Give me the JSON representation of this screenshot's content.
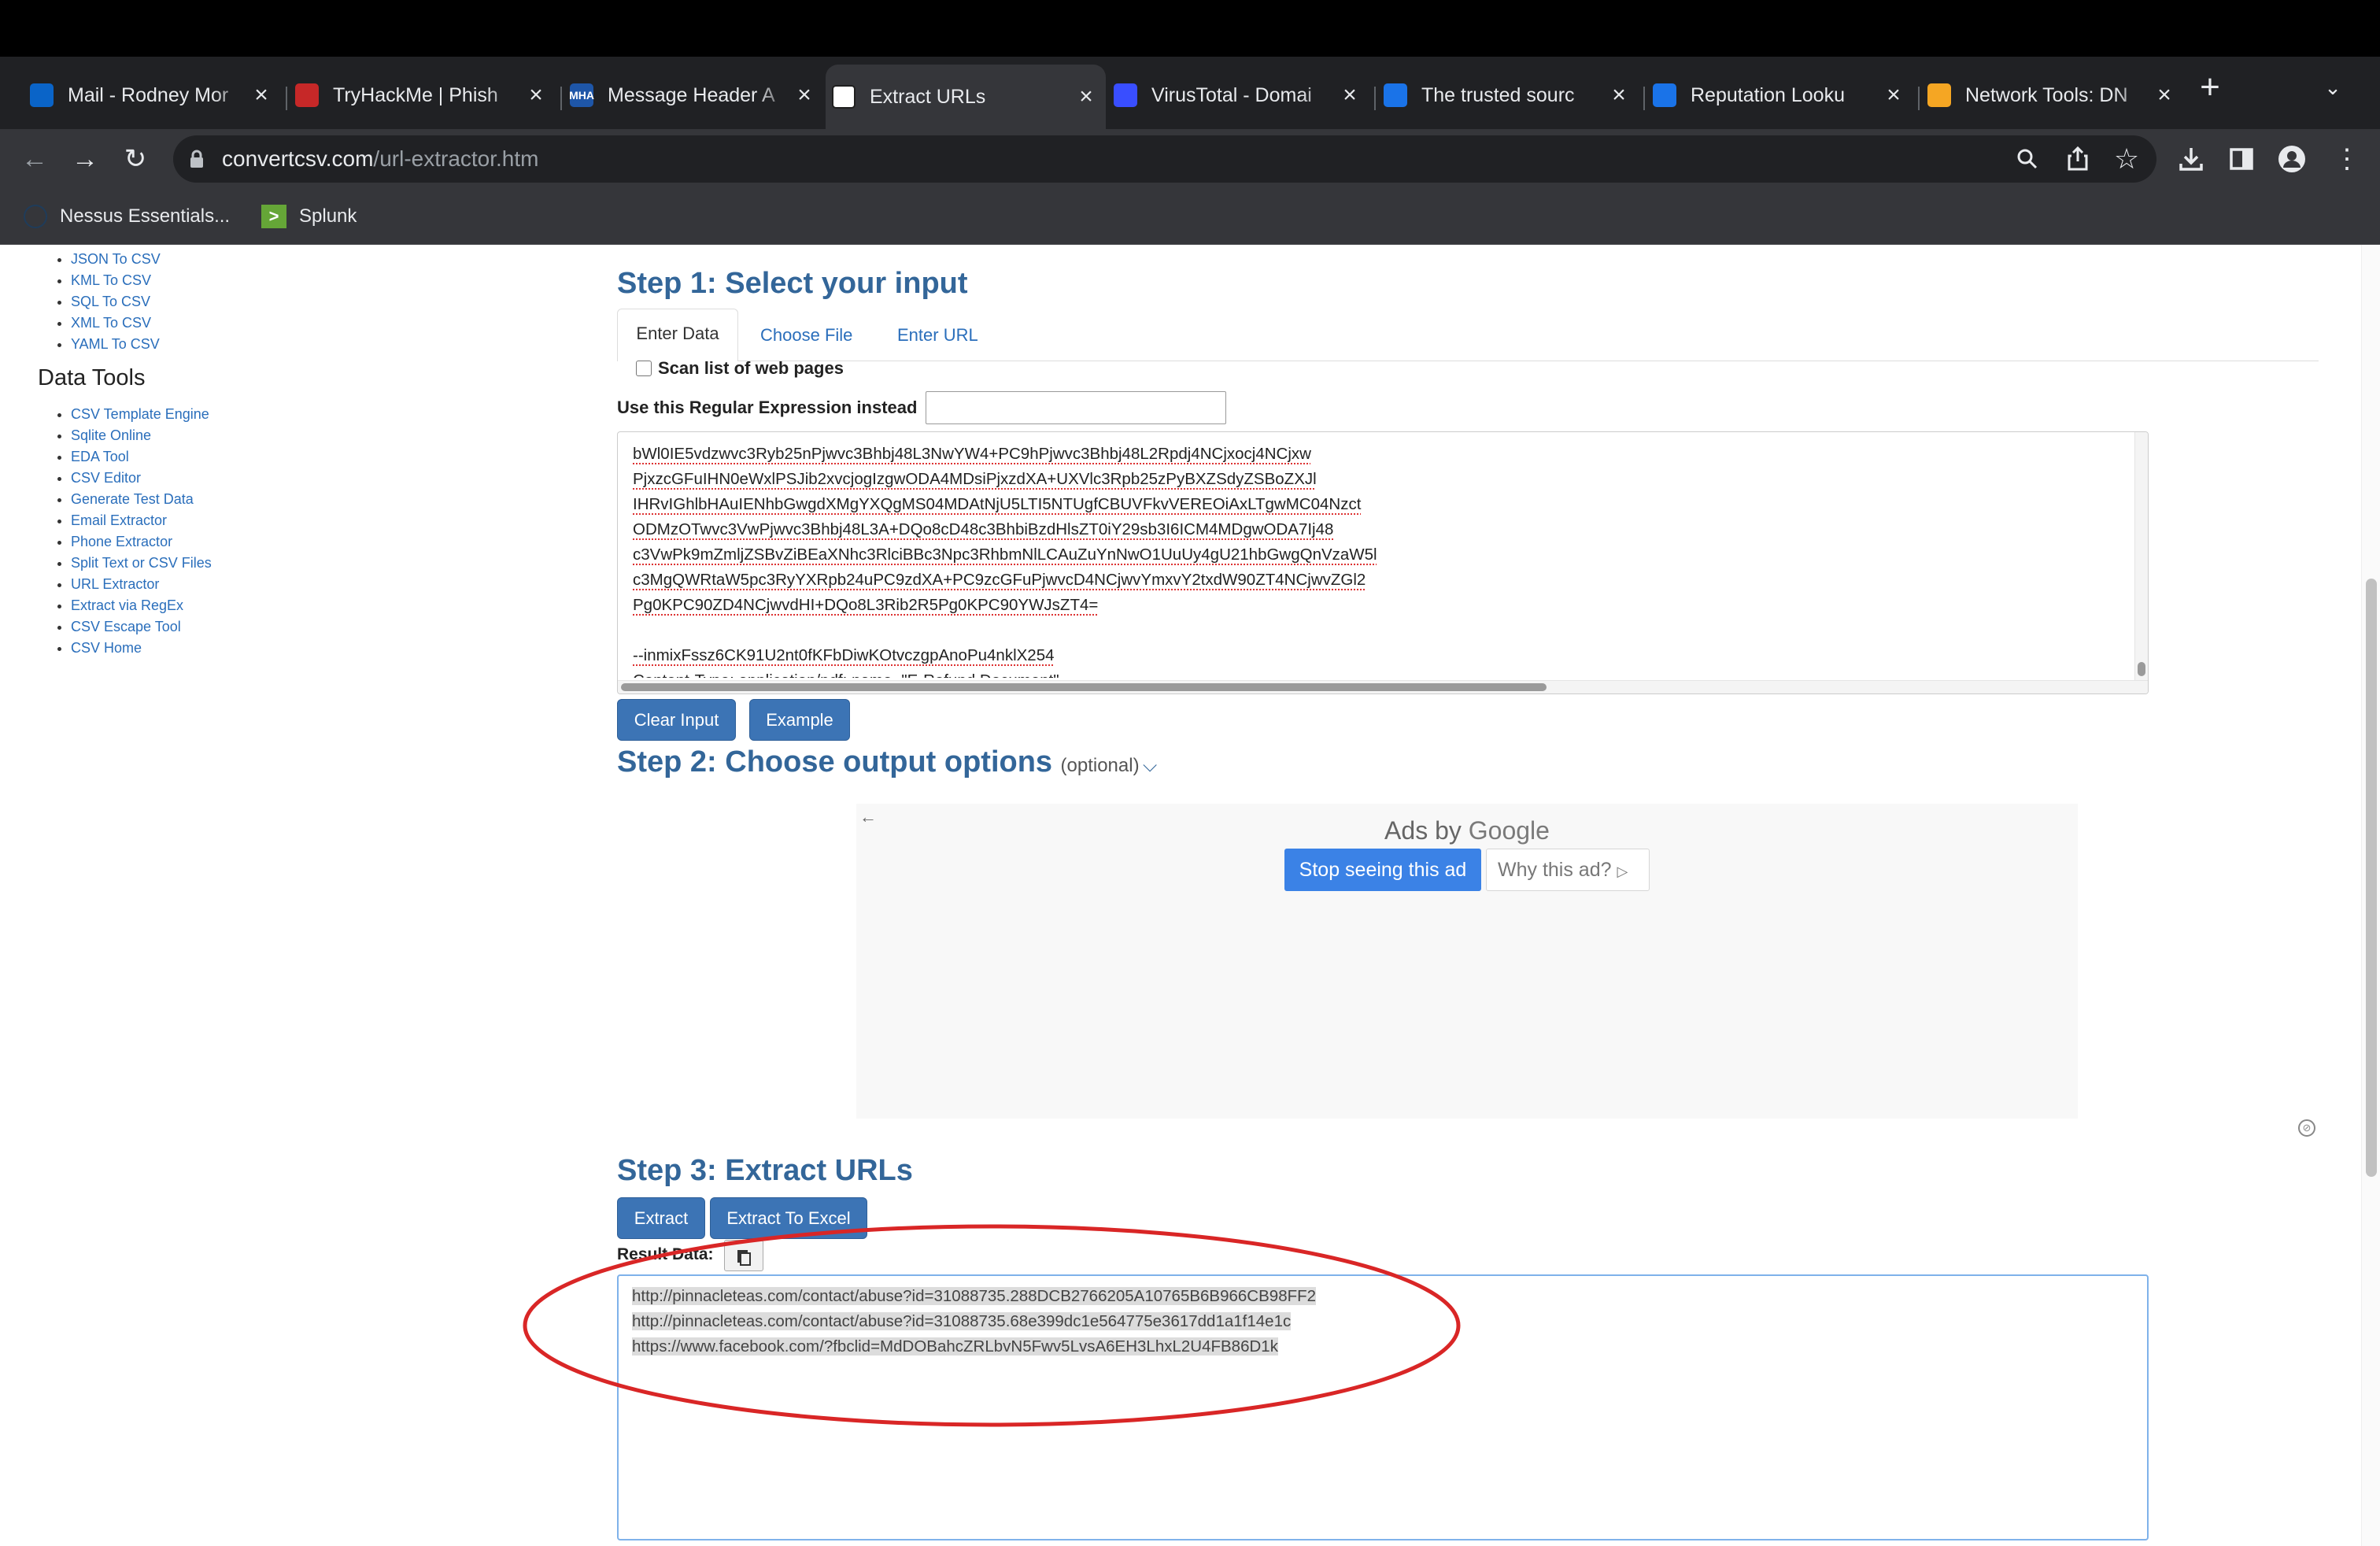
{
  "browser": {
    "tabs": [
      {
        "title": "Mail - Rodney Mor",
        "active": false,
        "favicon_color": "#0a64c8",
        "favicon": "outlook-icon"
      },
      {
        "title": "TryHackMe | Phish",
        "active": false,
        "favicon_color": "#c62828",
        "favicon": "tryhackme-icon"
      },
      {
        "title": "Message Header A",
        "active": false,
        "favicon_color": "#1e56a8",
        "favicon": "mha-icon",
        "favicon_text": "MHA"
      },
      {
        "title": "Extract URLs",
        "active": true,
        "favicon_color": "#ffffff",
        "favicon": "convertcsv-icon"
      },
      {
        "title": "VirusTotal - Domai",
        "active": false,
        "favicon_color": "#394eff",
        "favicon": "virustotal-icon"
      },
      {
        "title": "The trusted sourc",
        "active": false,
        "favicon_color": "#1a73e8",
        "favicon": "location-pin-icon"
      },
      {
        "title": "Reputation Looku",
        "active": false,
        "favicon_color": "#1a73e8",
        "favicon": "circle-icon"
      },
      {
        "title": "Network Tools: DN",
        "active": false,
        "favicon_color": "#f5a623",
        "favicon": "network-tools-icon"
      }
    ],
    "url_domain": "convertcsv.com",
    "url_path": "/url-extractor.htm",
    "bookmarks": [
      {
        "label": "Nessus Essentials...",
        "icon": "nessus-icon"
      },
      {
        "label": "Splunk",
        "icon": "splunk-icon",
        "icon_text": ">"
      }
    ]
  },
  "sidebar": {
    "convert_items": [
      "JSON To CSV",
      "KML To CSV",
      "SQL To CSV",
      "XML To CSV",
      "YAML To CSV"
    ],
    "data_tools_heading": "Data Tools",
    "data_tools_items": [
      "CSV Template Engine",
      "Sqlite Online",
      "EDA Tool",
      "CSV Editor",
      "Generate Test Data",
      "Email Extractor",
      "Phone Extractor",
      "Split Text or CSV Files",
      "URL Extractor",
      "Extract via RegEx",
      "CSV Escape Tool",
      "CSV Home"
    ]
  },
  "step1": {
    "heading": "Step 1: Select your input",
    "tabs": [
      "Enter Data",
      "Choose File",
      "Enter URL"
    ],
    "scan_label": "Scan list of web pages",
    "regex_label": "Use this Regular Expression instead",
    "regex_value": "",
    "input_text": "bWl0IE5vdzwvc3Ryb25nPjwvc3Bhbj48L3NwYW4+PC9hPjwvc3Bhbj48L2Rpdj4NCjxocj4NCjxw\nPjxzcGFuIHN0eWxlPSJib2xvcjogIzgwODA4MDsiPjxzdXA+UXVlc3Rpb25zPyBXZSdyZSBoZXJl\nIHRvIGhlbHAuIENhbGwgdXMgYXQgMS04MDAtNjU5LTI5NTUgfCBUVFkvVEREOiAxLTgwMC04Nzct\nODMzOTwvc3VwPjwvc3Bhbj48L3A+DQo8cD48c3BhbiBzdHlsZT0iY29sb3I6ICM4MDgwODA7Ij48\nc3VwPk9mZmljZSBvZiBEaXNhc3RlciBBc3Npc3RhbmNlLCAuZuYnNwO1UuUy4gU21hbGwgQnVzaW5l\nc3MgQWRtaW5pc3RyYXRpb24uPC9zdXA+PC9zcGFuPjwvcD4NCjwvYmxvY2txdW90ZT4NCjwvZGl2\nPg0KPC90ZD4NCjwvdHI+DQo8L3Rib2R5Pg0KPC90YWJsZT4=\n\n--inmixFssz6CK91U2nt0fKFbDiwKOtvczgpAnoPu4nklX254\nContent-Type: application/pdf; name=\"E-Refund.Document\""
  },
  "buttons": {
    "clear_input": "Clear Input",
    "example": "Example",
    "extract": "Extract",
    "extract_excel": "Extract To Excel"
  },
  "step2": {
    "heading": "Step 2: Choose output options",
    "optional": "(optional)",
    "ad_label": "Ads by",
    "ad_brand": "Google",
    "stop_seeing": "Stop seeing this ad",
    "why_ad": "Why this ad?"
  },
  "step3": {
    "heading": "Step 3: Extract URLs",
    "result_label": "Result Data:",
    "result_text": "http://pinnacleteas.com/contact/abuse?id=31088735.288DCB2766205A10765B6B966CB98FF2\nhttp://pinnacleteas.com/contact/abuse?id=31088735.68e399dc1e564775e3617dd1a1f14e1c\nhttps://www.facebook.com/?fbclid=MdDOBahcZRLbvN5Fwv5LvsA6EH3LhxL2U4FB86D1k"
  },
  "colors": {
    "link": "#2a6ebb",
    "heading": "#336699",
    "button": "#3c74b5",
    "annotation": "#d92626"
  }
}
